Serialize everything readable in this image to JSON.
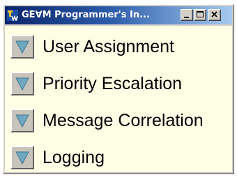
{
  "window": {
    "title": "GE∀M Programmer's In...",
    "app_icon": "app-logo-icon",
    "controls": {
      "minimize_icon": "minimize-icon",
      "maximize_icon": "maximize-icon",
      "close_icon": "close-icon"
    }
  },
  "menu": {
    "items": [
      {
        "label": "User Assignment",
        "icon": "triangle-down-icon"
      },
      {
        "label": "Priority Escalation",
        "icon": "triangle-down-icon"
      },
      {
        "label": "Message Correlation",
        "icon": "triangle-down-icon"
      },
      {
        "label": "Logging",
        "icon": "triangle-down-icon"
      }
    ]
  },
  "colors": {
    "titlebar_start": "#0a246a",
    "titlebar_end": "#a6caf0",
    "client_background": "#ffffe6",
    "button_triangle": "#6fa8c0"
  }
}
